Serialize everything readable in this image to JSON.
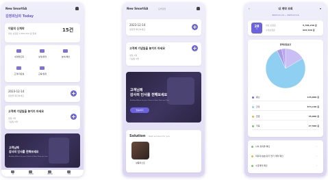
{
  "colors": {
    "accent": "#6c63e0",
    "pie_main": "#8fd0f2",
    "pie_slice": "#b8a6f0"
  },
  "screen1": {
    "app_title": "New SmartGA",
    "today_title": "김영희님의 Today",
    "contract_label": "이달의 신계약",
    "contract_count": "15건",
    "contract_sub": "월납 보험료 4,800,000 원 달성",
    "quick_menu": [
      {
        "label": "내계약조회",
        "icon": "search-icon"
      },
      {
        "label": "설계/청약",
        "icon": "document-icon"
      },
      {
        "label": "분석/제안",
        "icon": "chat-icon"
      },
      {
        "label": "고객/자료실",
        "icon": "folder-icon"
      },
      {
        "label": "교육/일정",
        "icon": "calendar-icon"
      }
    ],
    "schedule_date": "2023-12-14",
    "schedule_sub": "일정을 확인하세요",
    "anniversary_title": "고객께 기념일을 놓치지 마세요",
    "anniversary_items": [
      "생일 1명",
      "기념일 5명"
    ],
    "banner_line1": "고객님께",
    "banner_line2": "감사의 인사를 전해보세요",
    "banner_sub": "Birthday Wishes for your Clients to Show Them you Care",
    "tabs": [
      "홈",
      "고객관리",
      "영업지원",
      "전체"
    ]
  },
  "screen2": {
    "app_title": "New SmartGA",
    "app_badge": "모바일앱",
    "schedule_date": "2023-12-14",
    "schedule_sub": "일정을 확인하세요",
    "anniversary_title": "고객께 기념일을 놓치지 마세요",
    "anniversary_items": [
      "생일 1명",
      "기념일 5명"
    ],
    "banner_line1": "고객님께",
    "banner_line2": "감사의 인사를 전해보세요",
    "banner_sub": "Birthday Wishes for your Clients to Show Them you Care",
    "banner_button": "전송하기",
    "solution_title": "Solution",
    "solution_sub": "Best solution for you",
    "solution_caption": "상품리스트"
  },
  "screen3": {
    "header_title": "내 계약 조회",
    "period": "2023-11-14 ~ 2023-12-14",
    "count": "28",
    "count_unit": "건",
    "summary": [
      {
        "label": "월납 보험료",
        "value": "5,708,240 원"
      },
      {
        "label": "수정보험료",
        "value": "923,540 원"
      }
    ],
    "chart_title": "판매상품분포",
    "legend": [
      {
        "label": "종신",
        "value": "145,890 원"
      },
      {
        "label": "건강",
        "value": "674,130 원"
      },
      {
        "label": "연금",
        "value": "35,000 원"
      },
      {
        "label": "저축",
        "value": "27,500 원"
      }
    ],
    "links": [
      "나의 유지율 확인",
      "미유지/실효/장기 연기 계약 확인",
      "수금계약 확인"
    ]
  },
  "chart_data": {
    "type": "pie",
    "title": "판매상품분포",
    "categories": [
      "종신",
      "건강",
      "연금",
      "저축"
    ],
    "values": [
      145890,
      674130,
      35000,
      27500
    ]
  }
}
